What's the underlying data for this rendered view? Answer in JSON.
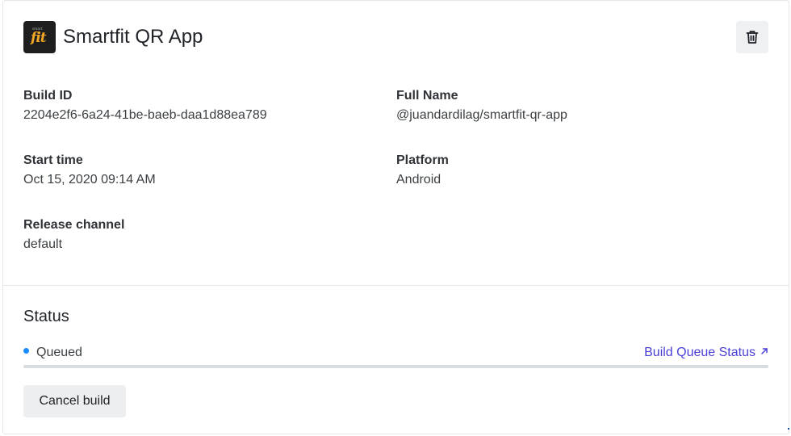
{
  "app": {
    "title": "Smartfit QR App",
    "logo_small_text": "smart",
    "logo_text": "fit"
  },
  "header": {
    "delete_icon": "trash-icon"
  },
  "details": {
    "build_id": {
      "label": "Build ID",
      "value": "2204e2f6-6a24-41be-baeb-daa1d88ea789"
    },
    "full_name": {
      "label": "Full Name",
      "value": "@juandardilag/smartfit-qr-app"
    },
    "start_time": {
      "label": "Start time",
      "value": "Oct 15, 2020 09:14 AM"
    },
    "platform": {
      "label": "Platform",
      "value": "Android"
    },
    "release_channel": {
      "label": "Release channel",
      "value": "default"
    }
  },
  "status": {
    "title": "Status",
    "state": "Queued",
    "dot_color": "#1a8cff",
    "queue_link_label": "Build Queue Status",
    "queue_link_icon": "external-arrow-icon"
  },
  "actions": {
    "cancel_label": "Cancel build"
  },
  "colors": {
    "accent": "#4a3fd6",
    "logo_brand": "#f5a623"
  }
}
